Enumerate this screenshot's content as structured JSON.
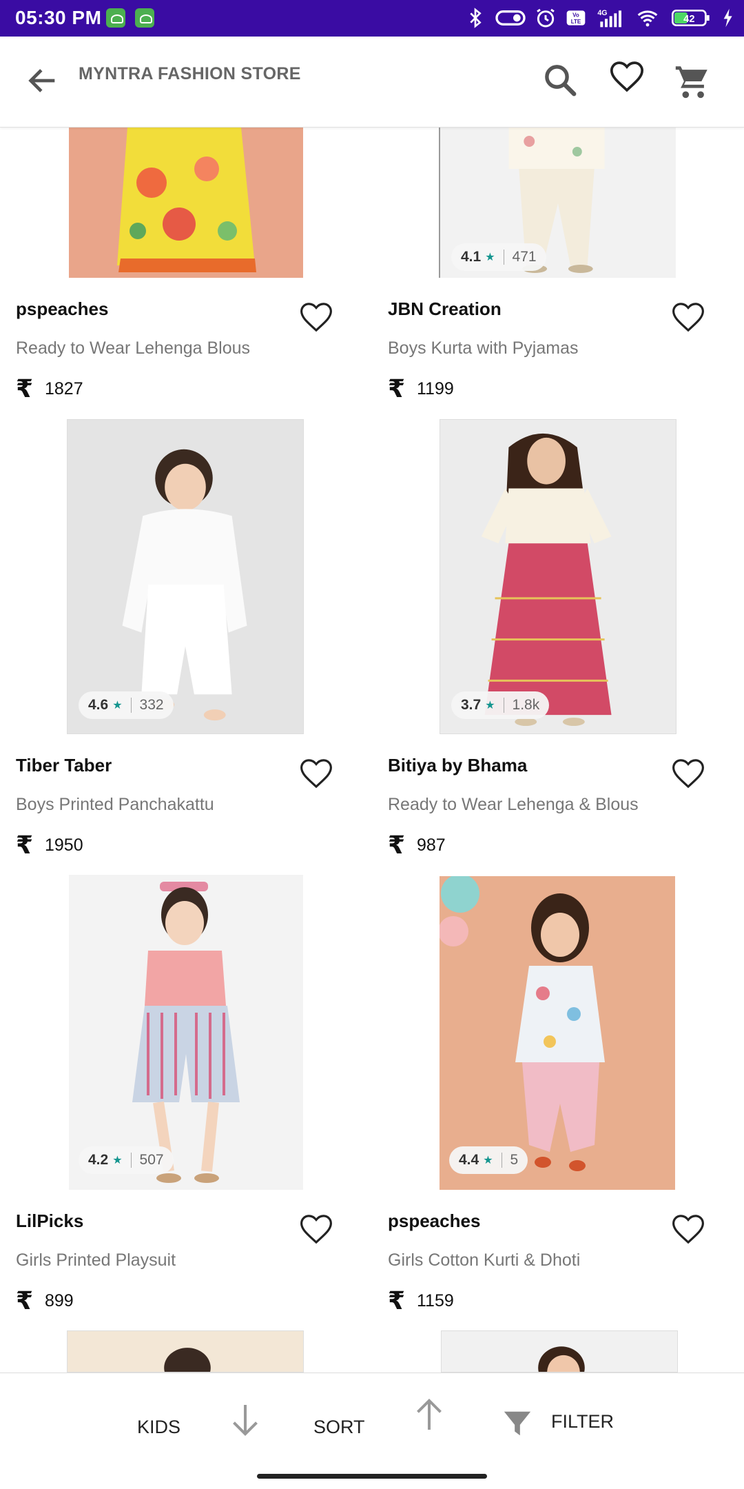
{
  "status_bar": {
    "time": "05:30 PM",
    "network": "4G",
    "battery": "42",
    "volte": "Vo LTE"
  },
  "header": {
    "title": "MYNTRA FASHION STORE"
  },
  "products": [
    {
      "brand": "pspeaches",
      "name": "Ready to Wear Lehenga Blous",
      "price": "1827",
      "rating": "",
      "count": ""
    },
    {
      "brand": "JBN Creation",
      "name": "Boys Kurta with Pyjamas",
      "price": "1199",
      "rating": "4.1",
      "count": "471"
    },
    {
      "brand": "Tiber Taber",
      "name": "Boys Printed Panchakattu",
      "price": "1950",
      "rating": "4.6",
      "count": "332"
    },
    {
      "brand": "Bitiya by Bhama",
      "name": "Ready to Wear Lehenga & Blous",
      "price": "987",
      "rating": "3.7",
      "count": "1.8k"
    },
    {
      "brand": "LilPicks",
      "name": "Girls Printed Playsuit",
      "price": "899",
      "rating": "4.2",
      "count": "507"
    },
    {
      "brand": "pspeaches",
      "name": "Girls Cotton Kurti & Dhoti",
      "price": "1159",
      "rating": "4.4",
      "count": "5"
    }
  ],
  "currency_symbol": "₹",
  "bottom_bar": {
    "category_label": "KIDS",
    "sort_label": "SORT",
    "filter_label": "FILTER"
  },
  "colors": {
    "status_bar": "#3a0ca3",
    "rating_star": "#14958f",
    "header_title": "#666666"
  }
}
